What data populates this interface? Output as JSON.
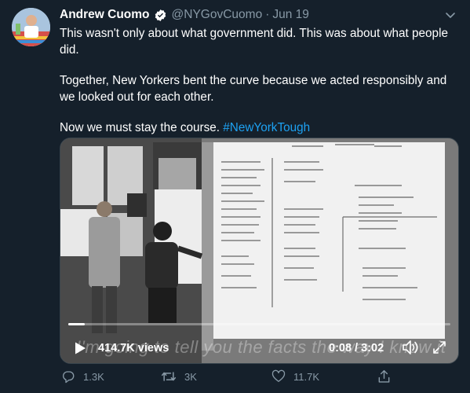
{
  "tweet": {
    "author_name": "Andrew Cuomo",
    "handle": "@NYGovCuomo",
    "separator": "·",
    "date": "Jun 19",
    "paragraphs": [
      "This wasn't only about what government did. This was about what people did.",
      "Together, New Yorkers bent the curve because we acted responsibly and we looked out for each other."
    ],
    "last_line_text": "Now we must stay the course. ",
    "hashtag": "#NewYorkTough"
  },
  "video": {
    "caption": "I'm going to tell you the facts the way I know it",
    "views": "414.7K views",
    "time": "0:08 / 3:02",
    "progress": 0.044
  },
  "actions": {
    "reply_count": "1.3K",
    "retweet_count": "3K",
    "like_count": "11.7K"
  },
  "colors": {
    "background": "#15202b",
    "secondary_text": "#8899a6",
    "accent": "#1da1f2"
  },
  "icons": [
    "verified-badge-icon",
    "chevron-down-icon",
    "play-icon",
    "volume-icon",
    "fullscreen-icon",
    "reply-icon",
    "retweet-icon",
    "like-icon",
    "share-icon"
  ]
}
